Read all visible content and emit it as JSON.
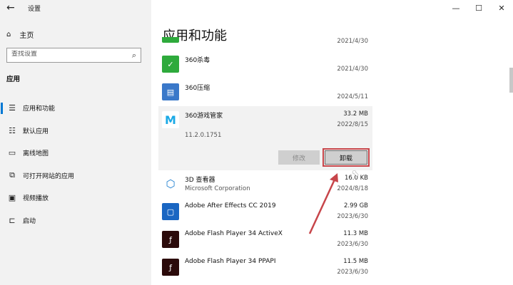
{
  "window": {
    "title": "设置",
    "controls": [
      "minimize",
      "maximize",
      "close"
    ]
  },
  "sidebar": {
    "home_label": "主页",
    "search_placeholder": "查找设置",
    "section_label": "应用",
    "items": [
      {
        "label": "应用和功能",
        "icon": "list-icon",
        "active": true
      },
      {
        "label": "默认应用",
        "icon": "default-apps-icon",
        "active": false
      },
      {
        "label": "离线地图",
        "icon": "map-icon",
        "active": false
      },
      {
        "label": "可打开网站的应用",
        "icon": "link-window-icon",
        "active": false
      },
      {
        "label": "视频播放",
        "icon": "video-icon",
        "active": false
      },
      {
        "label": "启动",
        "icon": "startup-icon",
        "active": false
      }
    ]
  },
  "main": {
    "page_title": "应用和功能",
    "apps": [
      {
        "name": "",
        "publisher": "",
        "size": "",
        "date": "2021/4/30"
      },
      {
        "name": "360杀毒",
        "publisher": "",
        "size": "",
        "date": "2021/4/30",
        "icon_color": "#2eaa3c"
      },
      {
        "name": "360压缩",
        "publisher": "",
        "size": "",
        "date": "2024/5/11",
        "icon_color": "#3a78c9"
      },
      {
        "name": "360游戏管家",
        "publisher": "",
        "size": "33.2 MB",
        "date": "2022/8/15",
        "version": "11.2.0.1751",
        "icon_color": "#1aa9e6",
        "expanded": true
      },
      {
        "name": "3D 查看器",
        "publisher": "Microsoft Corporation",
        "size": "16.0 KB",
        "date": "2024/8/18",
        "icon_color": "#1f7fd0"
      },
      {
        "name": "Adobe After Effects CC 2019",
        "publisher": "",
        "size": "2.99 GB",
        "date": "2023/6/30",
        "icon_color": "#1a66c2"
      },
      {
        "name": "Adobe Flash Player 34 ActiveX",
        "publisher": "",
        "size": "11.3 MB",
        "date": "2023/6/30",
        "icon_color": "#2b0a0a"
      },
      {
        "name": "Adobe Flash Player 34 PPAPI",
        "publisher": "",
        "size": "11.5 MB",
        "date": "2023/6/30",
        "icon_color": "#2b0a0a"
      }
    ],
    "buttons": {
      "modify": "修改",
      "uninstall": "卸载"
    },
    "annotation_color": "#c7454a"
  }
}
